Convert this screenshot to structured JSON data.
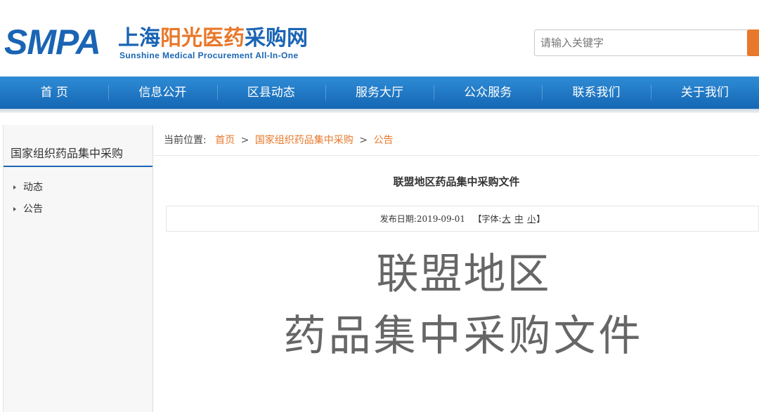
{
  "header": {
    "logo_abbr": "SMPA",
    "logo_cn_part1": "上海",
    "logo_cn_part2": "阳光医药",
    "logo_cn_part3": "采购网",
    "logo_en": "Sunshine Medical Procurement All-In-One",
    "search_placeholder": "请输入关键字"
  },
  "nav": {
    "items": [
      "首 页",
      "信息公开",
      "区县动态",
      "服务大厅",
      "公众服务",
      "联系我们",
      "关于我们"
    ]
  },
  "sidebar": {
    "title": "国家组织药品集中采购",
    "items": [
      "动态",
      "公告"
    ]
  },
  "breadcrumb": {
    "prefix": "当前位置:",
    "items": [
      "首页",
      "国家组织药品集中采购",
      "公告"
    ],
    "separator": ">"
  },
  "article": {
    "title": "联盟地区药品集中采购文件",
    "publish_label": "发布日期:",
    "publish_date": "2019-09-01",
    "font_label": "【字体:",
    "font_large": "大",
    "font_medium": "中",
    "font_small": "小",
    "font_close": "】",
    "hero_line1": "联盟地区",
    "hero_line2": "药品集中采购文件"
  },
  "colors": {
    "brand_blue": "#1a64b4",
    "accent_orange": "#e8782a"
  }
}
